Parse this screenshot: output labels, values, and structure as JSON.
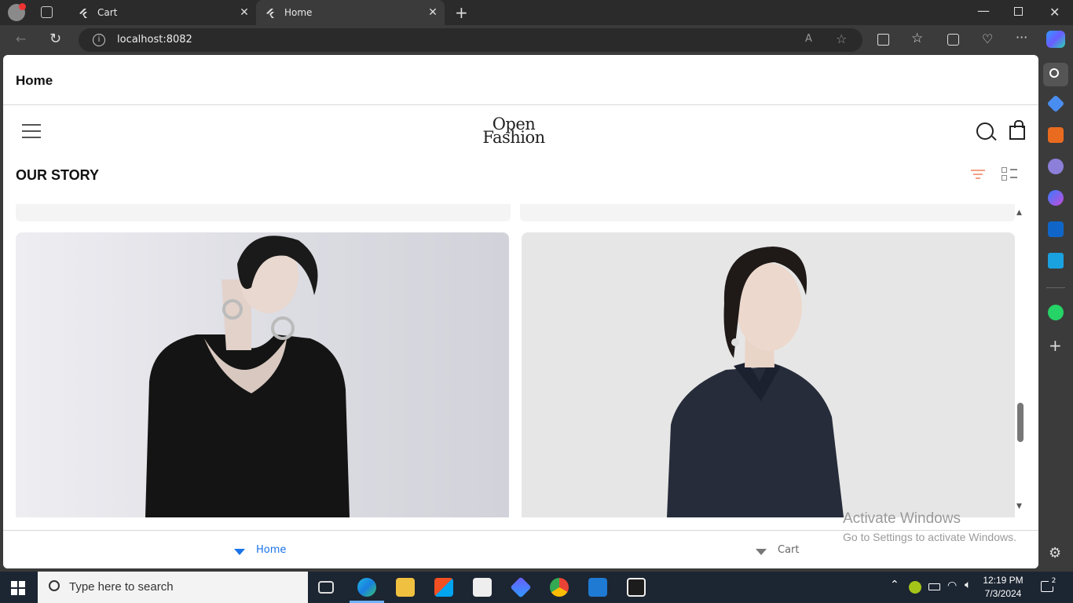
{
  "browser": {
    "tabs": [
      {
        "title": "Cart",
        "active": false
      },
      {
        "title": "Home",
        "active": true
      }
    ],
    "url": "localhost:8082"
  },
  "app": {
    "bar_title": "Home",
    "logo_line1": "Open",
    "logo_line2": "Fashion",
    "section_title": "OUR STORY"
  },
  "bottom_tabs": [
    {
      "label": "Home",
      "active": true
    },
    {
      "label": "Cart",
      "active": false
    }
  ],
  "watermark": {
    "line1": "Activate Windows",
    "line2": "Go to Settings to activate Windows."
  },
  "taskbar": {
    "search_placeholder": "Type here to search",
    "time": "12:19 PM",
    "date": "7/3/2024",
    "notification_count": "2"
  },
  "colors": {
    "accent_blue": "#1a73e8",
    "filter_orange": "#f2a085"
  }
}
